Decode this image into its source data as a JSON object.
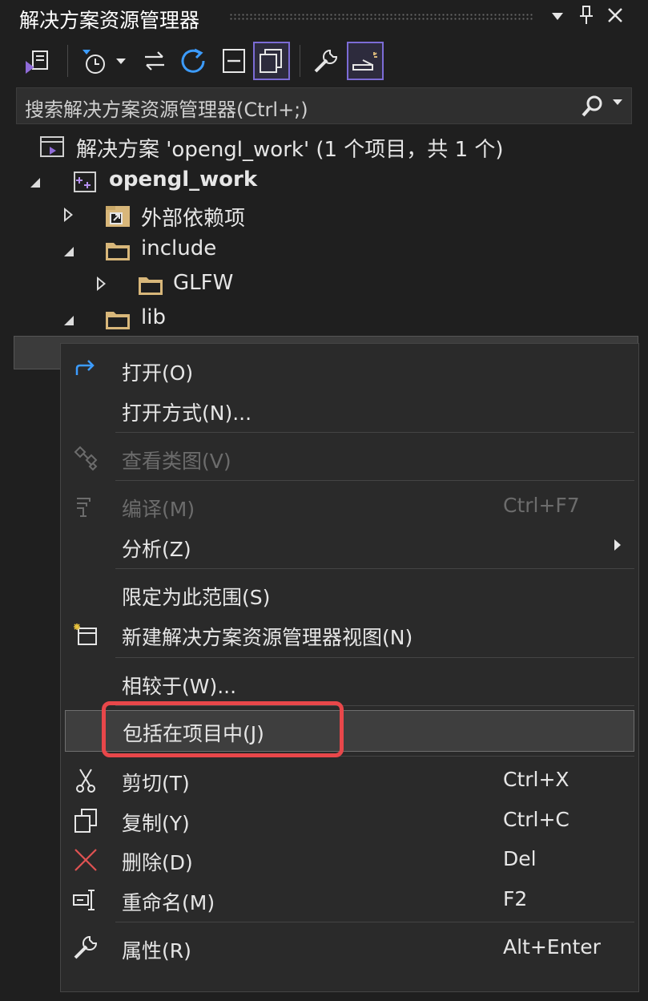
{
  "panel": {
    "title": "解决方案资源管理器",
    "dropdown_glyph": "▾",
    "pin_glyph": "📌",
    "close_glyph": "✕"
  },
  "toolbar": {
    "icons": [
      "vs-solution-switch-icon",
      "pending-changes-history-icon",
      "sync-with-document-icon",
      "refresh-icon",
      "collapse-all-icon",
      "show-all-files-icon",
      "properties-wrench-icon",
      "preview-selected-icon"
    ]
  },
  "search": {
    "placeholder": "搜索解决方案资源管理器(Ctrl+;)"
  },
  "tree": {
    "solution_label": "解决方案 'opengl_work' (1 个项目，共 1 个)",
    "project_label": "opengl_work",
    "external_deps_label": "外部依赖项",
    "include_label": "include",
    "glfw_label": "GLFW",
    "lib_label": "lib"
  },
  "context_menu": {
    "open": {
      "label": "打开(O)"
    },
    "open_with": {
      "label": "打开方式(N)..."
    },
    "view_class_diagram": {
      "label": "查看类图(V)"
    },
    "compile": {
      "label": "编译(M)",
      "shortcut": "Ctrl+F7"
    },
    "analyze": {
      "label": "分析(Z)"
    },
    "scope_to_this": {
      "label": "限定为此范围(S)"
    },
    "new_view": {
      "label": "新建解决方案资源管理器视图(N)"
    },
    "compare_with": {
      "label": "相较于(W)..."
    },
    "include_in_project": {
      "label": "包括在项目中(J)"
    },
    "cut": {
      "label": "剪切(T)",
      "shortcut": "Ctrl+X"
    },
    "copy": {
      "label": "复制(Y)",
      "shortcut": "Ctrl+C"
    },
    "delete": {
      "label": "删除(D)",
      "shortcut": "Del"
    },
    "rename": {
      "label": "重命名(M)",
      "shortcut": "F2"
    },
    "properties": {
      "label": "属性(R)",
      "shortcut": "Alt+Enter"
    }
  },
  "colors": {
    "background": "#1f1f1f",
    "menu_bg": "#2a2a2a",
    "accent": "#7c6cd6",
    "highlight_red": "#e8474a",
    "delete_red": "#e05252",
    "refresh_blue": "#3c9cff",
    "folder_tan": "#d8b77a"
  }
}
